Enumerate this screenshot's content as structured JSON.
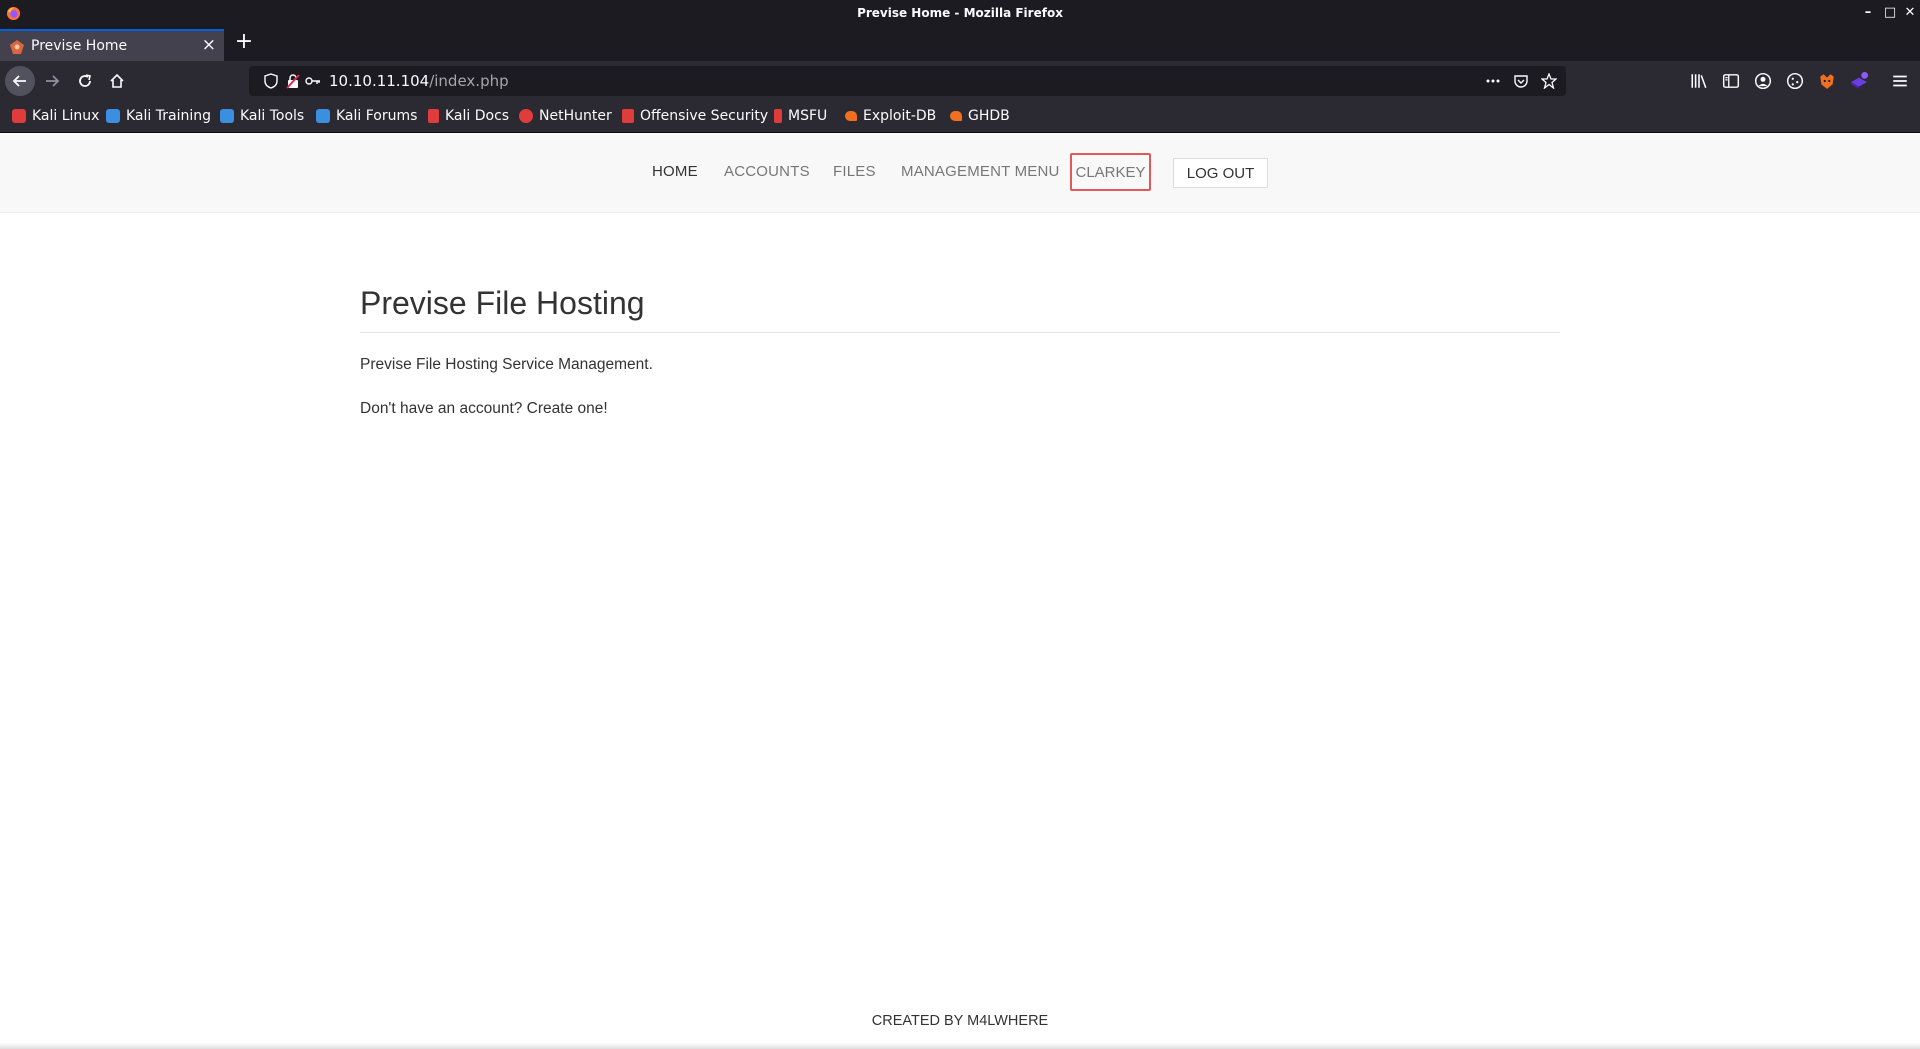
{
  "window": {
    "title": "Previse Home - Mozilla Firefox"
  },
  "tabs": [
    {
      "label": "Previse Home"
    }
  ],
  "urlbar": {
    "host": "10.10.11.104",
    "path": "/index.php"
  },
  "bookmarks": [
    {
      "label": "Kali Linux",
      "icon": "kali-dragon-icon",
      "color": "#e03c3c"
    },
    {
      "label": "Kali Training",
      "icon": "kali-training-icon",
      "color": "#3a8fe0"
    },
    {
      "label": "Kali Tools",
      "icon": "kali-tools-icon",
      "color": "#3a8fe0"
    },
    {
      "label": "Kali Forums",
      "icon": "kali-forums-icon",
      "color": "#3a8fe0"
    },
    {
      "label": "Kali Docs",
      "icon": "kali-docs-icon",
      "color": "#e03c3c"
    },
    {
      "label": "NetHunter",
      "icon": "nethunter-icon",
      "color": "#e03c3c"
    },
    {
      "label": "Offensive Security",
      "icon": "offsec-icon",
      "color": "#e03c3c"
    },
    {
      "label": "MSFU",
      "icon": "msfu-icon",
      "color": "#e03c3c"
    },
    {
      "label": "Exploit-DB",
      "icon": "exploit-db-icon",
      "color": "#f07020"
    },
    {
      "label": "GHDB",
      "icon": "ghdb-icon",
      "color": "#f07020"
    }
  ],
  "site_nav": {
    "home": "HOME",
    "accounts": "ACCOUNTS",
    "files": "FILES",
    "management": "MANAGEMENT MENU",
    "user": "CLARKEY",
    "logout": "LOG OUT"
  },
  "main": {
    "title": "Previse File Hosting",
    "intro": "Previse File Hosting Service Management.",
    "signup_text": "Don't have an account? Create one!"
  },
  "footer": {
    "text": "CREATED BY M4LWHERE"
  },
  "colors": {
    "chrome_dark": "#1c1b22",
    "toolbar": "#2b2a33",
    "tab_active": "#42414d",
    "user_box_border": "#e05a5a"
  }
}
